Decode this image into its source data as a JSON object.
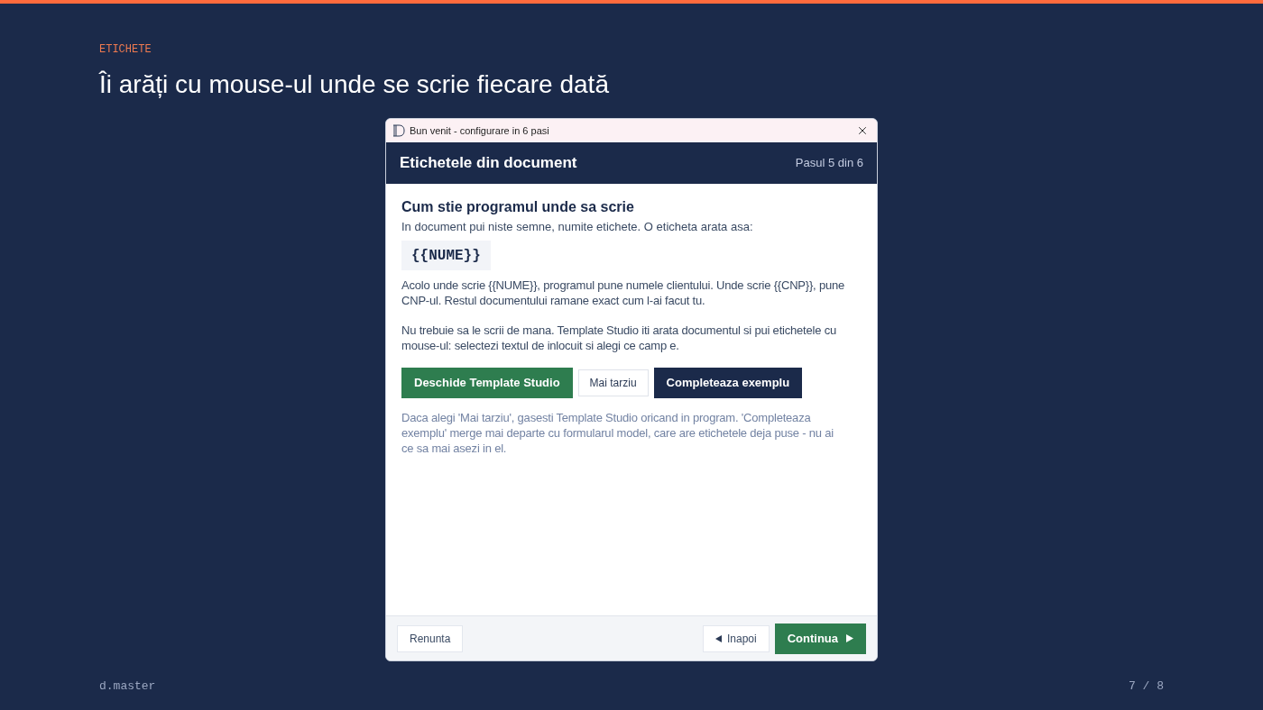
{
  "slide": {
    "eyebrow": "ETICHETE",
    "title": "Îi arăți cu mouse-ul unde se scrie fiecare dată"
  },
  "dialog": {
    "title": "Bun venit - configurare in 6 pasi",
    "header": {
      "title": "Etichetele din document",
      "step": "Pasul 5 din 6"
    },
    "section_title": "Cum stie programul unde sa scrie",
    "intro": "In document pui niste semne, numite etichete. O eticheta arata asa:",
    "tag_example": "{{NUME}}",
    "paragraphs": [
      "Acolo unde scrie {{NUME}}, programul pune numele clientului. Unde scrie {{CNP}}, pune CNP-ul. Restul documentului ramane exact cum l-ai facut tu.",
      "Nu trebuie sa le scrii de mana. Template Studio iti arata documentul si pui etichetele cu mouse-ul: selectezi textul de inlocuit si alegi ce camp e."
    ],
    "actions": [
      {
        "label": "Deschide Template Studio",
        "kind": "primary"
      },
      {
        "label": "Mai tarziu",
        "kind": "secondary"
      },
      {
        "label": "Completeaza exemplu",
        "kind": "dark"
      }
    ],
    "note": "Daca alegi 'Mai tarziu', gasesti Template Studio oricand in program. 'Completeaza exemplu' merge mai departe cu formularul model, care are etichetele deja puse - nu ai ce sa mai asezi in el.",
    "footer_buttons": [
      {
        "label": "Renunta",
        "kind": "cancel"
      },
      {
        "label": "Inapoi",
        "kind": "back"
      },
      {
        "label": "Continua",
        "kind": "next"
      }
    ]
  },
  "footer": {
    "brand": "d.master",
    "page": "7 / 8"
  }
}
